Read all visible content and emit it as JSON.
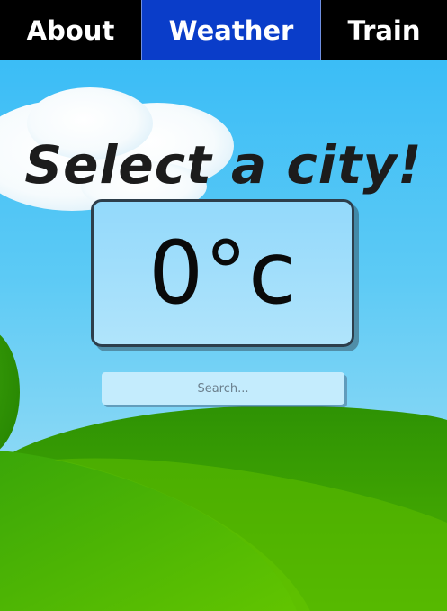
{
  "nav": {
    "tabs": [
      {
        "label": "About",
        "active": false
      },
      {
        "label": "Weather",
        "active": true
      },
      {
        "label": "Train",
        "active": false
      }
    ],
    "active_color": "#0a3dc9",
    "bar_color": "#000000"
  },
  "main": {
    "title": "Select a city!",
    "temperature": "0°c",
    "search": {
      "placeholder": "Search...",
      "value": ""
    }
  },
  "colors": {
    "sky": "#32b9f6",
    "hill": "#3aa10a",
    "temp_box": "#a6e0fb"
  }
}
